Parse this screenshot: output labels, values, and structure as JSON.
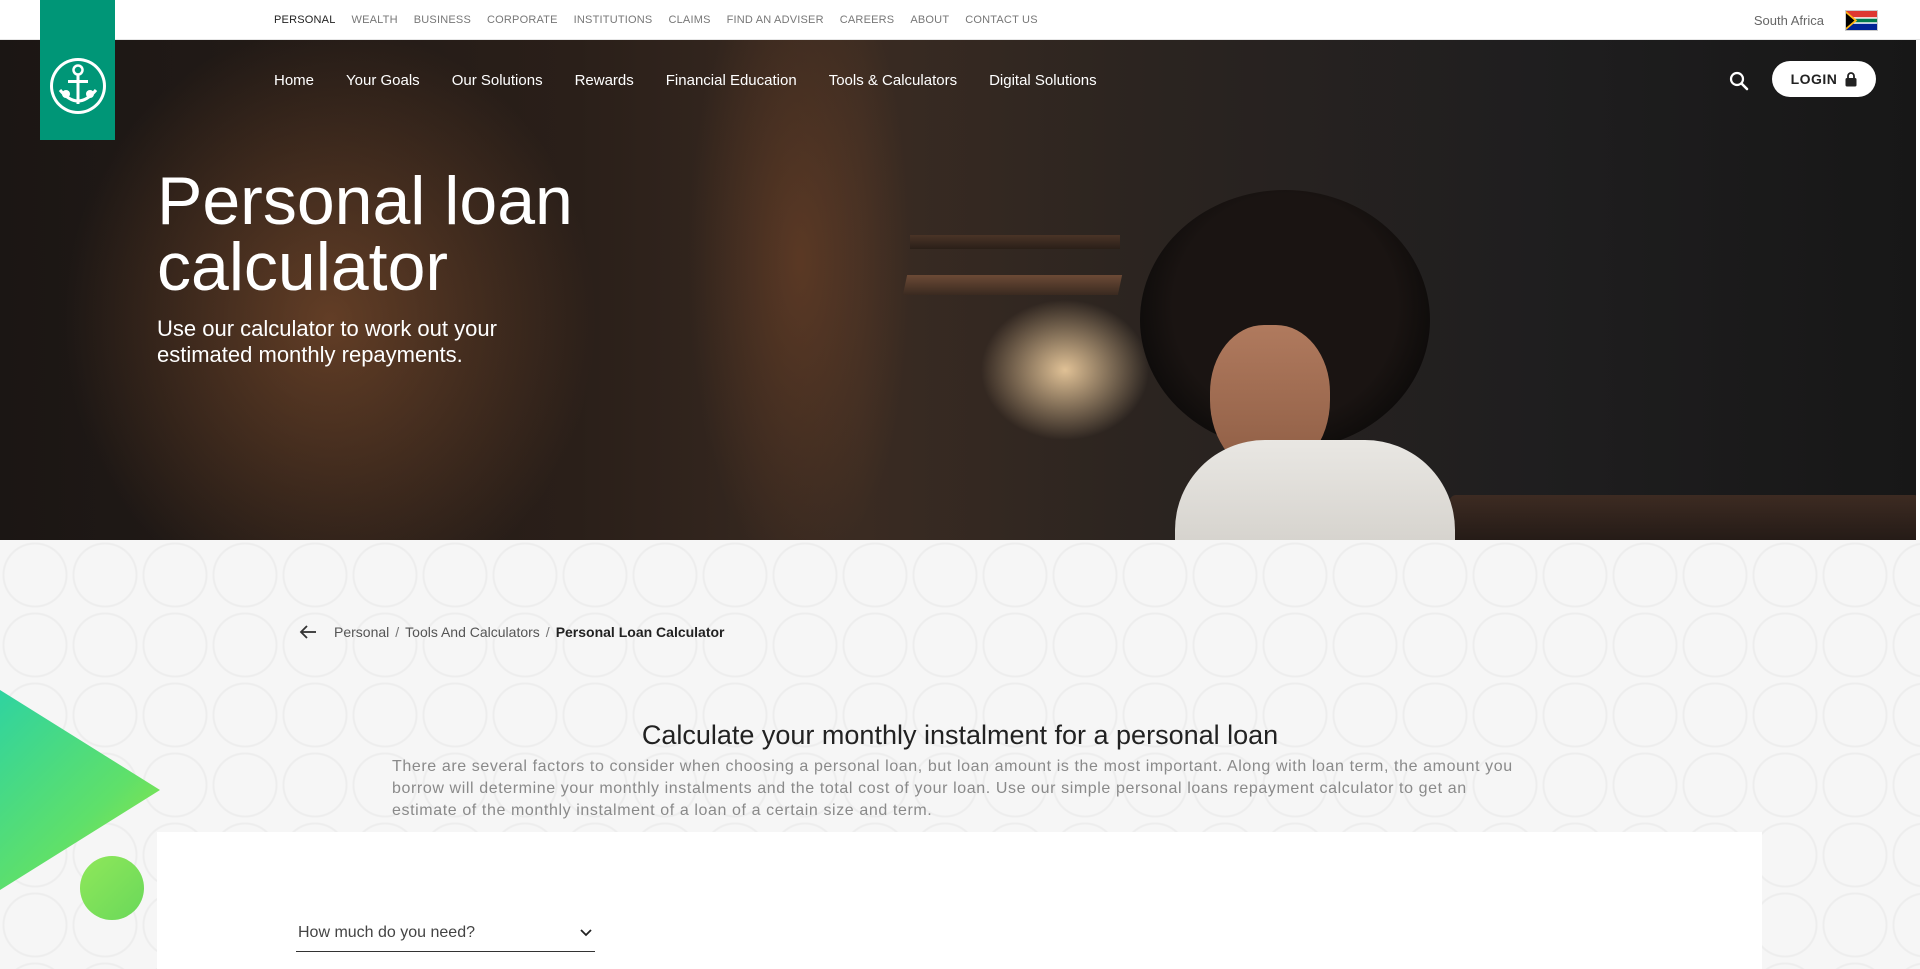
{
  "topbar": {
    "items": [
      {
        "label": "PERSONAL",
        "active": true
      },
      {
        "label": "WEALTH"
      },
      {
        "label": "BUSINESS"
      },
      {
        "label": "CORPORATE"
      },
      {
        "label": "INSTITUTIONS"
      },
      {
        "label": "CLAIMS"
      },
      {
        "label": "FIND AN ADVISER"
      },
      {
        "label": "CAREERS"
      },
      {
        "label": "ABOUT"
      },
      {
        "label": "CONTACT US"
      }
    ],
    "region": "South Africa"
  },
  "mainnav": {
    "items": [
      {
        "label": "Home"
      },
      {
        "label": "Your Goals"
      },
      {
        "label": "Our Solutions"
      },
      {
        "label": "Rewards"
      },
      {
        "label": "Financial Education"
      },
      {
        "label": "Tools & Calculators"
      },
      {
        "label": "Digital Solutions"
      }
    ],
    "login_label": "LOGIN"
  },
  "hero": {
    "title": "Personal loan calculator",
    "subtitle": "Use our calculator to work out your estimated monthly repayments."
  },
  "breadcrumb": {
    "items": [
      "Personal",
      "Tools And Calculators"
    ],
    "current": "Personal Loan Calculator",
    "separator": "/"
  },
  "calculator": {
    "title": "Calculate your monthly instalment for a personal loan",
    "description": "There are several factors to consider when choosing a personal loan, but loan amount is the most important. Along with loan term, the amount you borrow will determine your monthly instalments and the total cost of your loan. Use our simple personal loans repayment calculator to get an estimate of the monthly instalment of a loan of a certain size and term.",
    "amount_dropdown_label": "How much do you need?"
  },
  "colors": {
    "brand_green": "#009677",
    "accent_green": "#42d67b"
  }
}
